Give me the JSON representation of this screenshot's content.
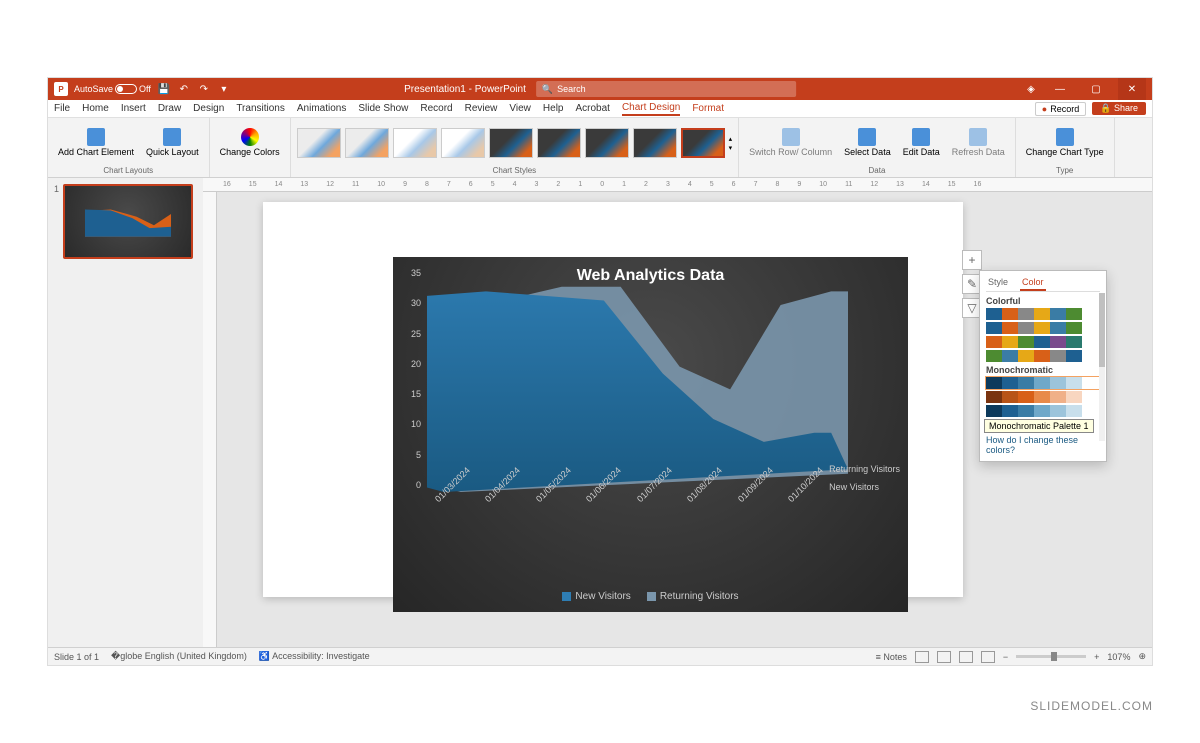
{
  "titlebar": {
    "autosave_label": "AutoSave",
    "autosave_state": "Off",
    "doc_title": "Presentation1 - PowerPoint",
    "search_placeholder": "Search"
  },
  "ribbon_tabs": [
    "File",
    "Home",
    "Insert",
    "Draw",
    "Design",
    "Transitions",
    "Animations",
    "Slide Show",
    "Record",
    "Review",
    "View",
    "Help",
    "Acrobat",
    "Chart Design",
    "Format"
  ],
  "ribbon_right": {
    "record": "Record",
    "share": "Share"
  },
  "ribbon": {
    "layouts": {
      "add_element": "Add Chart Element",
      "quick_layout": "Quick Layout",
      "group": "Chart Layouts"
    },
    "colors": {
      "change_colors": "Change Colors"
    },
    "styles_group": "Chart Styles",
    "data": {
      "switch": "Switch Row/ Column",
      "select": "Select Data",
      "edit": "Edit Data",
      "refresh": "Refresh Data",
      "group": "Data"
    },
    "type": {
      "change_type": "Change Chart Type",
      "group": "Type"
    }
  },
  "thumb": {
    "num": "1"
  },
  "chart": {
    "title": "Web Analytics Data",
    "legend": {
      "new": "New Visitors",
      "returning": "Returning Visitors"
    },
    "series_labels": {
      "returning": "Returning Visitors",
      "new": "New Visitors"
    }
  },
  "chart_data": {
    "type": "area",
    "title": "Web Analytics Data",
    "categories": [
      "01/03/2024",
      "01/04/2024",
      "01/05/2024",
      "01/06/2024",
      "01/07/2024",
      "01/08/2024",
      "01/09/2024",
      "01/10/2024"
    ],
    "series": [
      {
        "name": "New Visitors",
        "values": [
          31,
          32,
          31,
          30,
          19,
          12,
          9,
          10
        ]
      },
      {
        "name": "Returning Visitors",
        "values": [
          29,
          30,
          32,
          32,
          20,
          17,
          30,
          32
        ]
      }
    ],
    "ylabel": "",
    "xlabel": "",
    "ylim": [
      0,
      35
    ],
    "yticks": [
      0,
      5,
      10,
      15,
      20,
      25,
      30,
      35
    ]
  },
  "side_btns": {
    "plus": "+",
    "brush": "✎",
    "filter": "▽"
  },
  "popup": {
    "tab_style": "Style",
    "tab_color": "Color",
    "section_colorful": "Colorful",
    "section_mono": "Monochromatic",
    "tooltip": "Monochromatic Palette 1",
    "link": "How do I change these colors?"
  },
  "statusbar": {
    "slide": "Slide 1 of 1",
    "lang": "English (United Kingdom)",
    "access": "Accessibility: Investigate",
    "notes": "Notes",
    "zoom": "107%"
  },
  "watermark": "SLIDEMODEL.COM"
}
